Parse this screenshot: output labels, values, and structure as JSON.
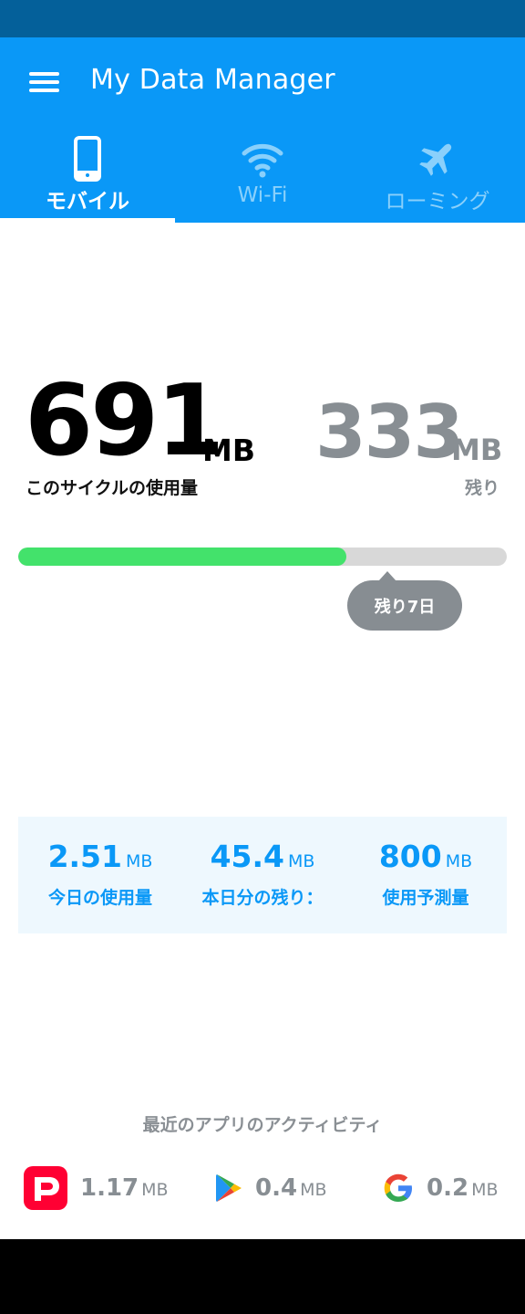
{
  "app": {
    "title": "My Data Manager"
  },
  "tabs": [
    {
      "label": "モバイル",
      "icon": "phone-icon",
      "active": true
    },
    {
      "label": "Wi-Fi",
      "icon": "wifi-icon",
      "active": false
    },
    {
      "label": "ローミング",
      "icon": "airplane-icon",
      "active": false
    }
  ],
  "usage": {
    "used_value": "691",
    "used_unit": "MB",
    "used_label": "このサイクルの使用量",
    "remaining_value": "333",
    "remaining_unit": "MB",
    "remaining_label": "残り",
    "progress_fraction": 0.672,
    "days_left": "残り7日"
  },
  "stats": [
    {
      "value": "2.51",
      "unit": "MB",
      "label": "今日の使用量"
    },
    {
      "value": "45.4",
      "unit": "MB",
      "label": "本日分の残り："
    },
    {
      "value": "800",
      "unit": "MB",
      "label": "使用予測量"
    }
  ],
  "activity": {
    "title": "最近のアプリのアクティビティ",
    "apps": [
      {
        "icon": "paypay-icon",
        "value": "1.17",
        "unit": "MB"
      },
      {
        "icon": "google-play-icon",
        "value": "0.4",
        "unit": "MB"
      },
      {
        "icon": "google-icon",
        "value": "0.2",
        "unit": "MB"
      }
    ]
  },
  "colors": {
    "accent": "#0a98f7",
    "status_bar": "#04609a",
    "progress_fill": "#43e26b",
    "muted": "#888e93"
  }
}
